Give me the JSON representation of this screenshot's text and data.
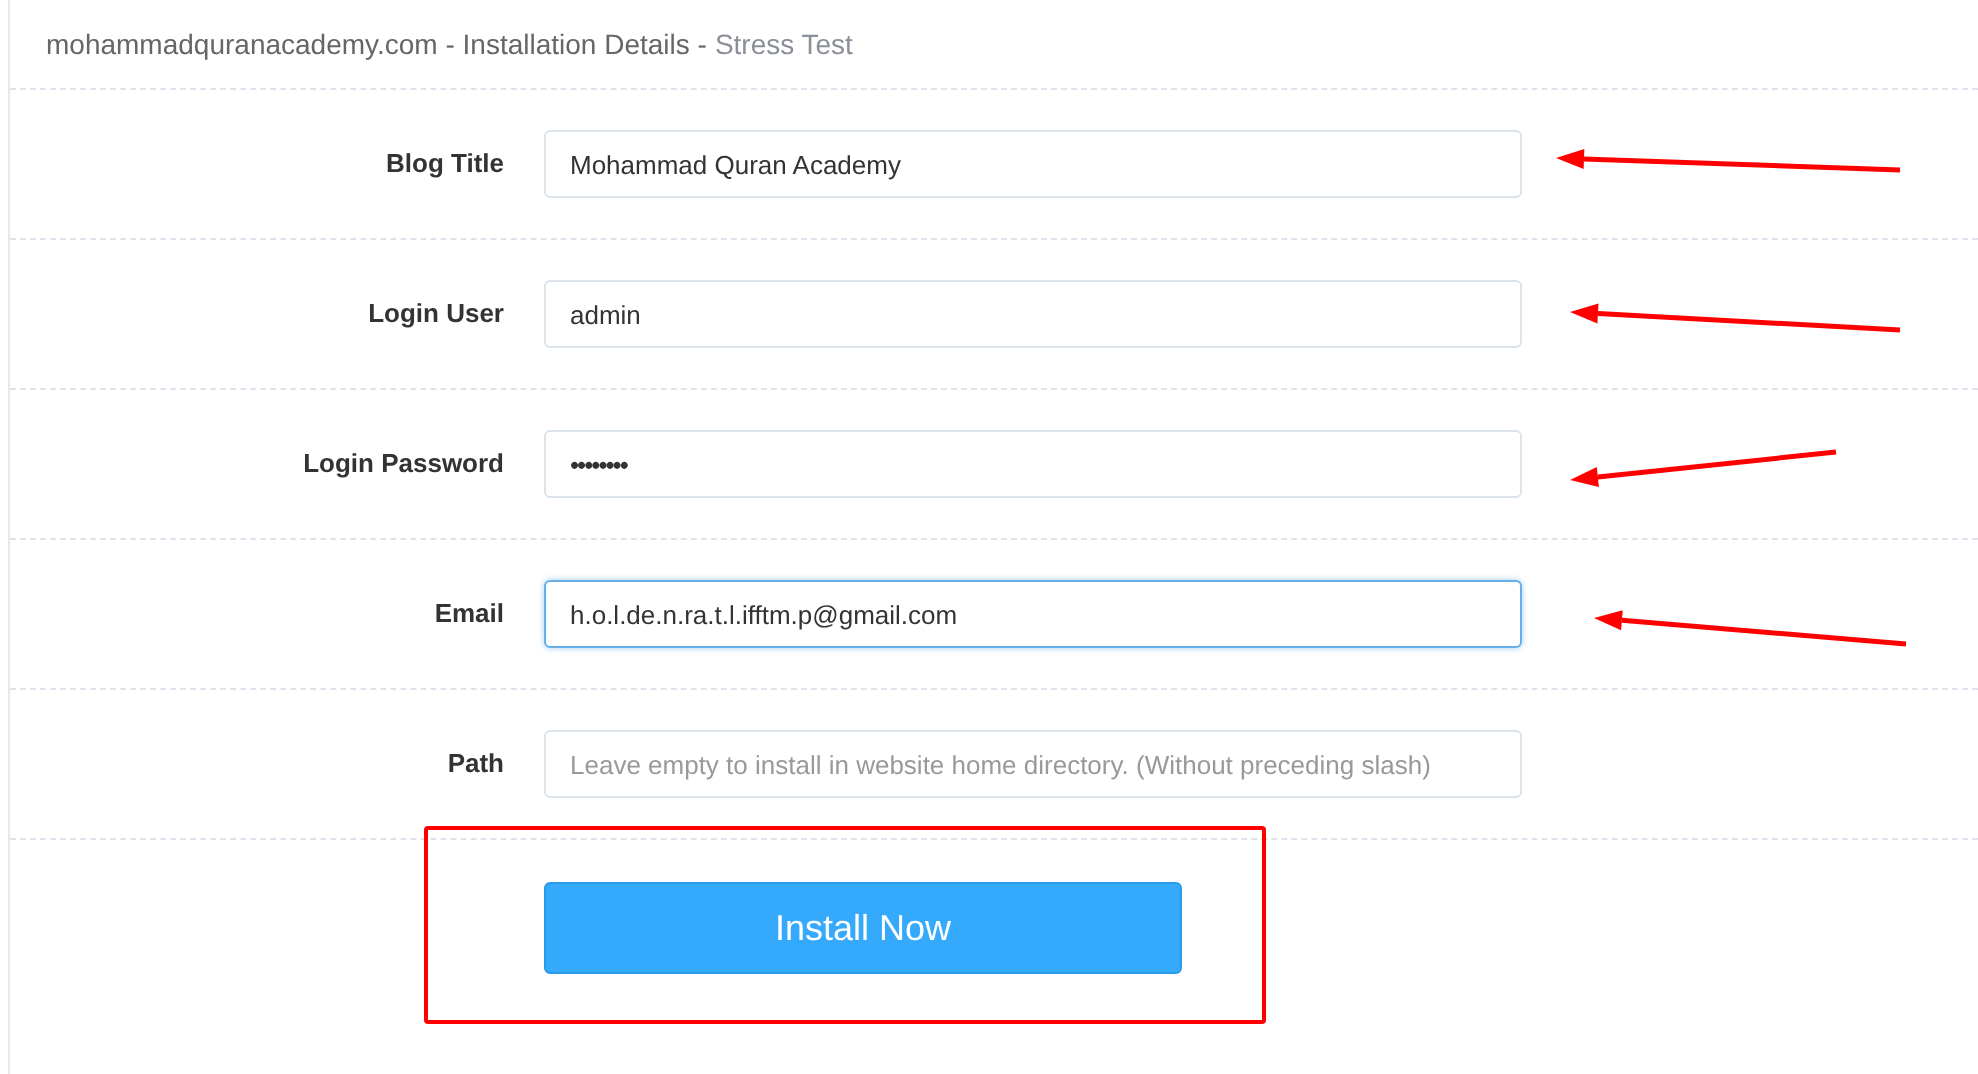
{
  "header": {
    "title": "mohammadquranacademy.com - Installation Details -",
    "subtitle": "Stress Test"
  },
  "fields": [
    {
      "label": "Blog Title",
      "kind": "text",
      "value": "Mohammad Quran Academy",
      "focused": false,
      "arrow": true
    },
    {
      "label": "Login User",
      "kind": "text",
      "value": "admin",
      "focused": false,
      "arrow": true
    },
    {
      "label": "Login Password",
      "kind": "password",
      "value": "••••••••",
      "focused": false,
      "arrow": true
    },
    {
      "label": "Email",
      "kind": "text",
      "value": "h.o.l.de.n.ra.t.l.ifftm.p@gmail.com",
      "focused": true,
      "arrow": true
    },
    {
      "label": "Path",
      "kind": "text",
      "placeholder": "Leave empty to install in website home directory. (Without preceding slash)",
      "focused": false,
      "arrow": false
    }
  ],
  "install_button": {
    "label": "Install Now",
    "highlighted": true
  }
}
